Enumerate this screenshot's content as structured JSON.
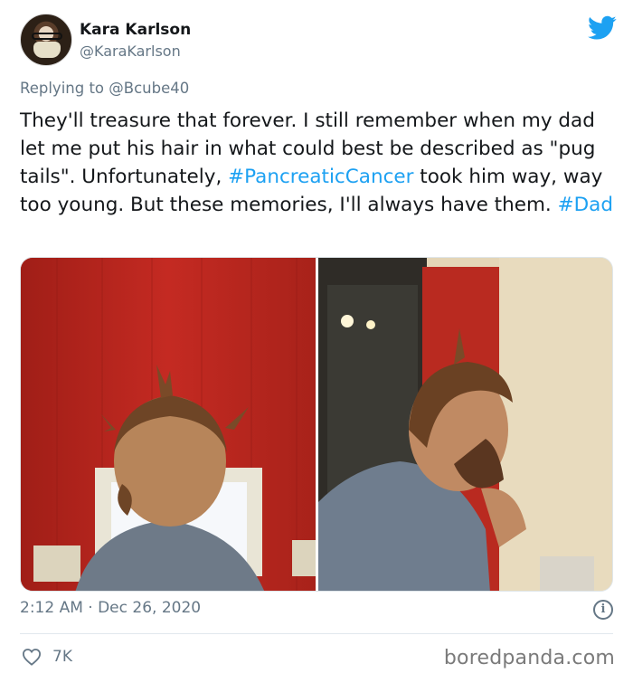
{
  "user": {
    "name": "Kara Karlson",
    "handle": "@KaraKarlson"
  },
  "reply": {
    "prefix": "Replying to",
    "mention": "@Bcube40"
  },
  "tweet": {
    "part1": "They'll treasure that forever. I still remember when my dad let me put his hair in what could best be described as \"pug tails\". Unfortunately, ",
    "hashtag1": "#PancreaticCancer",
    "part2": " took him way, way too young. But these memories, I'll always have them. ",
    "hashtag2": "#Dad"
  },
  "photos": [
    {
      "icon": "photo-back-of-head-pigtails"
    },
    {
      "icon": "photo-side-profile-pigtails"
    }
  ],
  "meta": {
    "timestamp": "2:12 AM · Dec 26, 2020",
    "info_glyph": "i"
  },
  "engagement": {
    "likes": "7K",
    "like_icon": "heart-icon"
  },
  "watermark": "boredpanda.com",
  "colors": {
    "link": "#1da1f2",
    "muted": "#657786",
    "text": "#14171a"
  }
}
